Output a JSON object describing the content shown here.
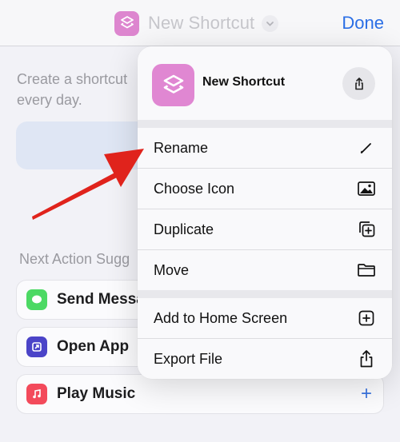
{
  "nav": {
    "title": "New Shortcut",
    "done_label": "Done"
  },
  "editor": {
    "description": "Create a shortcut\nevery day.",
    "next_label": "Next Action Sugg",
    "suggestions": [
      {
        "label": "Send Messa",
        "icon": "messages-icon",
        "color": "#4cd964"
      },
      {
        "label": "Open App",
        "icon": "open-app-icon",
        "color": "#4b44c8"
      },
      {
        "label": "Play Music",
        "icon": "music-icon",
        "color": "#f34a5b"
      }
    ]
  },
  "menu": {
    "shortcut_name": "New Shortcut",
    "items": [
      {
        "label": "Rename",
        "icon": "pencil-icon"
      },
      {
        "label": "Choose Icon",
        "icon": "photo-icon"
      },
      {
        "label": "Duplicate",
        "icon": "duplicate-icon"
      },
      {
        "label": "Move",
        "icon": "folder-icon"
      },
      {
        "label": "Add to Home Screen",
        "icon": "add-square-icon"
      },
      {
        "label": "Export File",
        "icon": "share-icon"
      }
    ]
  },
  "colors": {
    "accent": "#2b6fe6",
    "shortcut_icon": "#e087d2",
    "arrow": "#e0231c"
  }
}
